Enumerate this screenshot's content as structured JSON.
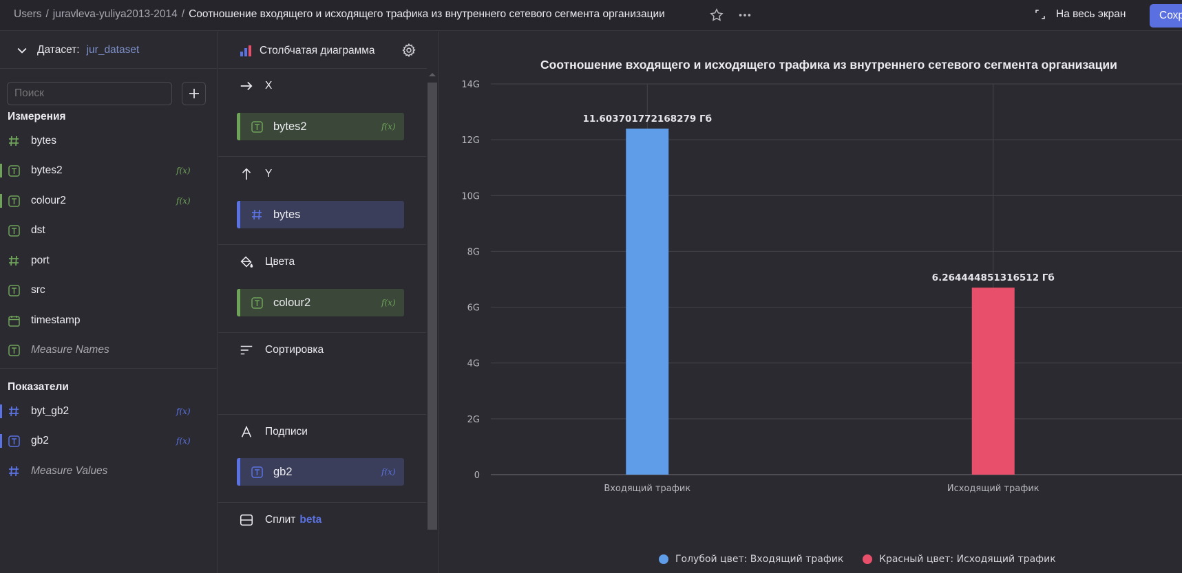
{
  "breadcrumb": {
    "items": [
      "Users",
      "juravleva-yuliya2013-2014"
    ],
    "separator": "/",
    "current": "Соотношение входящего и исходящего трафика из внутреннего сетевого сегмента организации"
  },
  "topbar": {
    "fullscreen_label": "На весь экран",
    "save_label": "Сохр",
    "icons": [
      "star-icon",
      "more-icon",
      "fullscreen-icon"
    ]
  },
  "dataset": {
    "label": "Датасет:",
    "name": "jur_dataset",
    "search_placeholder": "Поиск",
    "dimensions_title": "Измерения",
    "dimensions": [
      {
        "name": "bytes",
        "type": "number",
        "fx": false
      },
      {
        "name": "bytes2",
        "type": "text",
        "fx": true
      },
      {
        "name": "colour2",
        "type": "text",
        "fx": true
      },
      {
        "name": "dst",
        "type": "text",
        "fx": false
      },
      {
        "name": "port",
        "type": "number",
        "fx": false
      },
      {
        "name": "src",
        "type": "text",
        "fx": false
      },
      {
        "name": "timestamp",
        "type": "date",
        "fx": false
      },
      {
        "name": "Measure Names",
        "type": "text",
        "fx": false
      }
    ],
    "measures_title": "Показатели",
    "measures": [
      {
        "name": "byt_gb2",
        "type": "number",
        "fx": true
      },
      {
        "name": "gb2",
        "type": "text",
        "fx": true
      },
      {
        "name": "Measure Values",
        "type": "number",
        "fx": false
      }
    ],
    "fx_label": "f(x)"
  },
  "wizard": {
    "chart_type": "Столбчатая диаграмма",
    "x_label": "X",
    "x_field": "bytes2",
    "y_label": "Y",
    "y_field": "bytes",
    "colors_label": "Цвета",
    "colors_field": "colour2",
    "sort_label": "Сортировка",
    "labels_label": "Подписи",
    "labels_field": "gb2",
    "split_label": "Сплит",
    "split_badge": "beta",
    "fx_label": "f(x)"
  },
  "chart_data": {
    "type": "bar",
    "title": "Соотношение входящего и исходящего трафика из внутреннего сетевого сегмента организации",
    "categories": [
      "Входящий трафик",
      "Исходящий трафик"
    ],
    "values": [
      12.4,
      6.7
    ],
    "value_unit": "G",
    "data_labels": [
      "11.603701772168279 Гб",
      "6.264444851316512 Гб"
    ],
    "bar_colors": [
      "#5f9de8",
      "#e84f6a"
    ],
    "yticks": [
      "0",
      "2G",
      "4G",
      "6G",
      "8G",
      "10G",
      "12G",
      "14G"
    ],
    "ylim": [
      0,
      14
    ],
    "grid": true,
    "legend": [
      {
        "label": "Голубой цвет: Входящий трафик",
        "color": "#5f9de8"
      },
      {
        "label": "Красный цвет: Исходящий трафик",
        "color": "#e84f6a"
      }
    ],
    "legend_position": "bottom"
  }
}
